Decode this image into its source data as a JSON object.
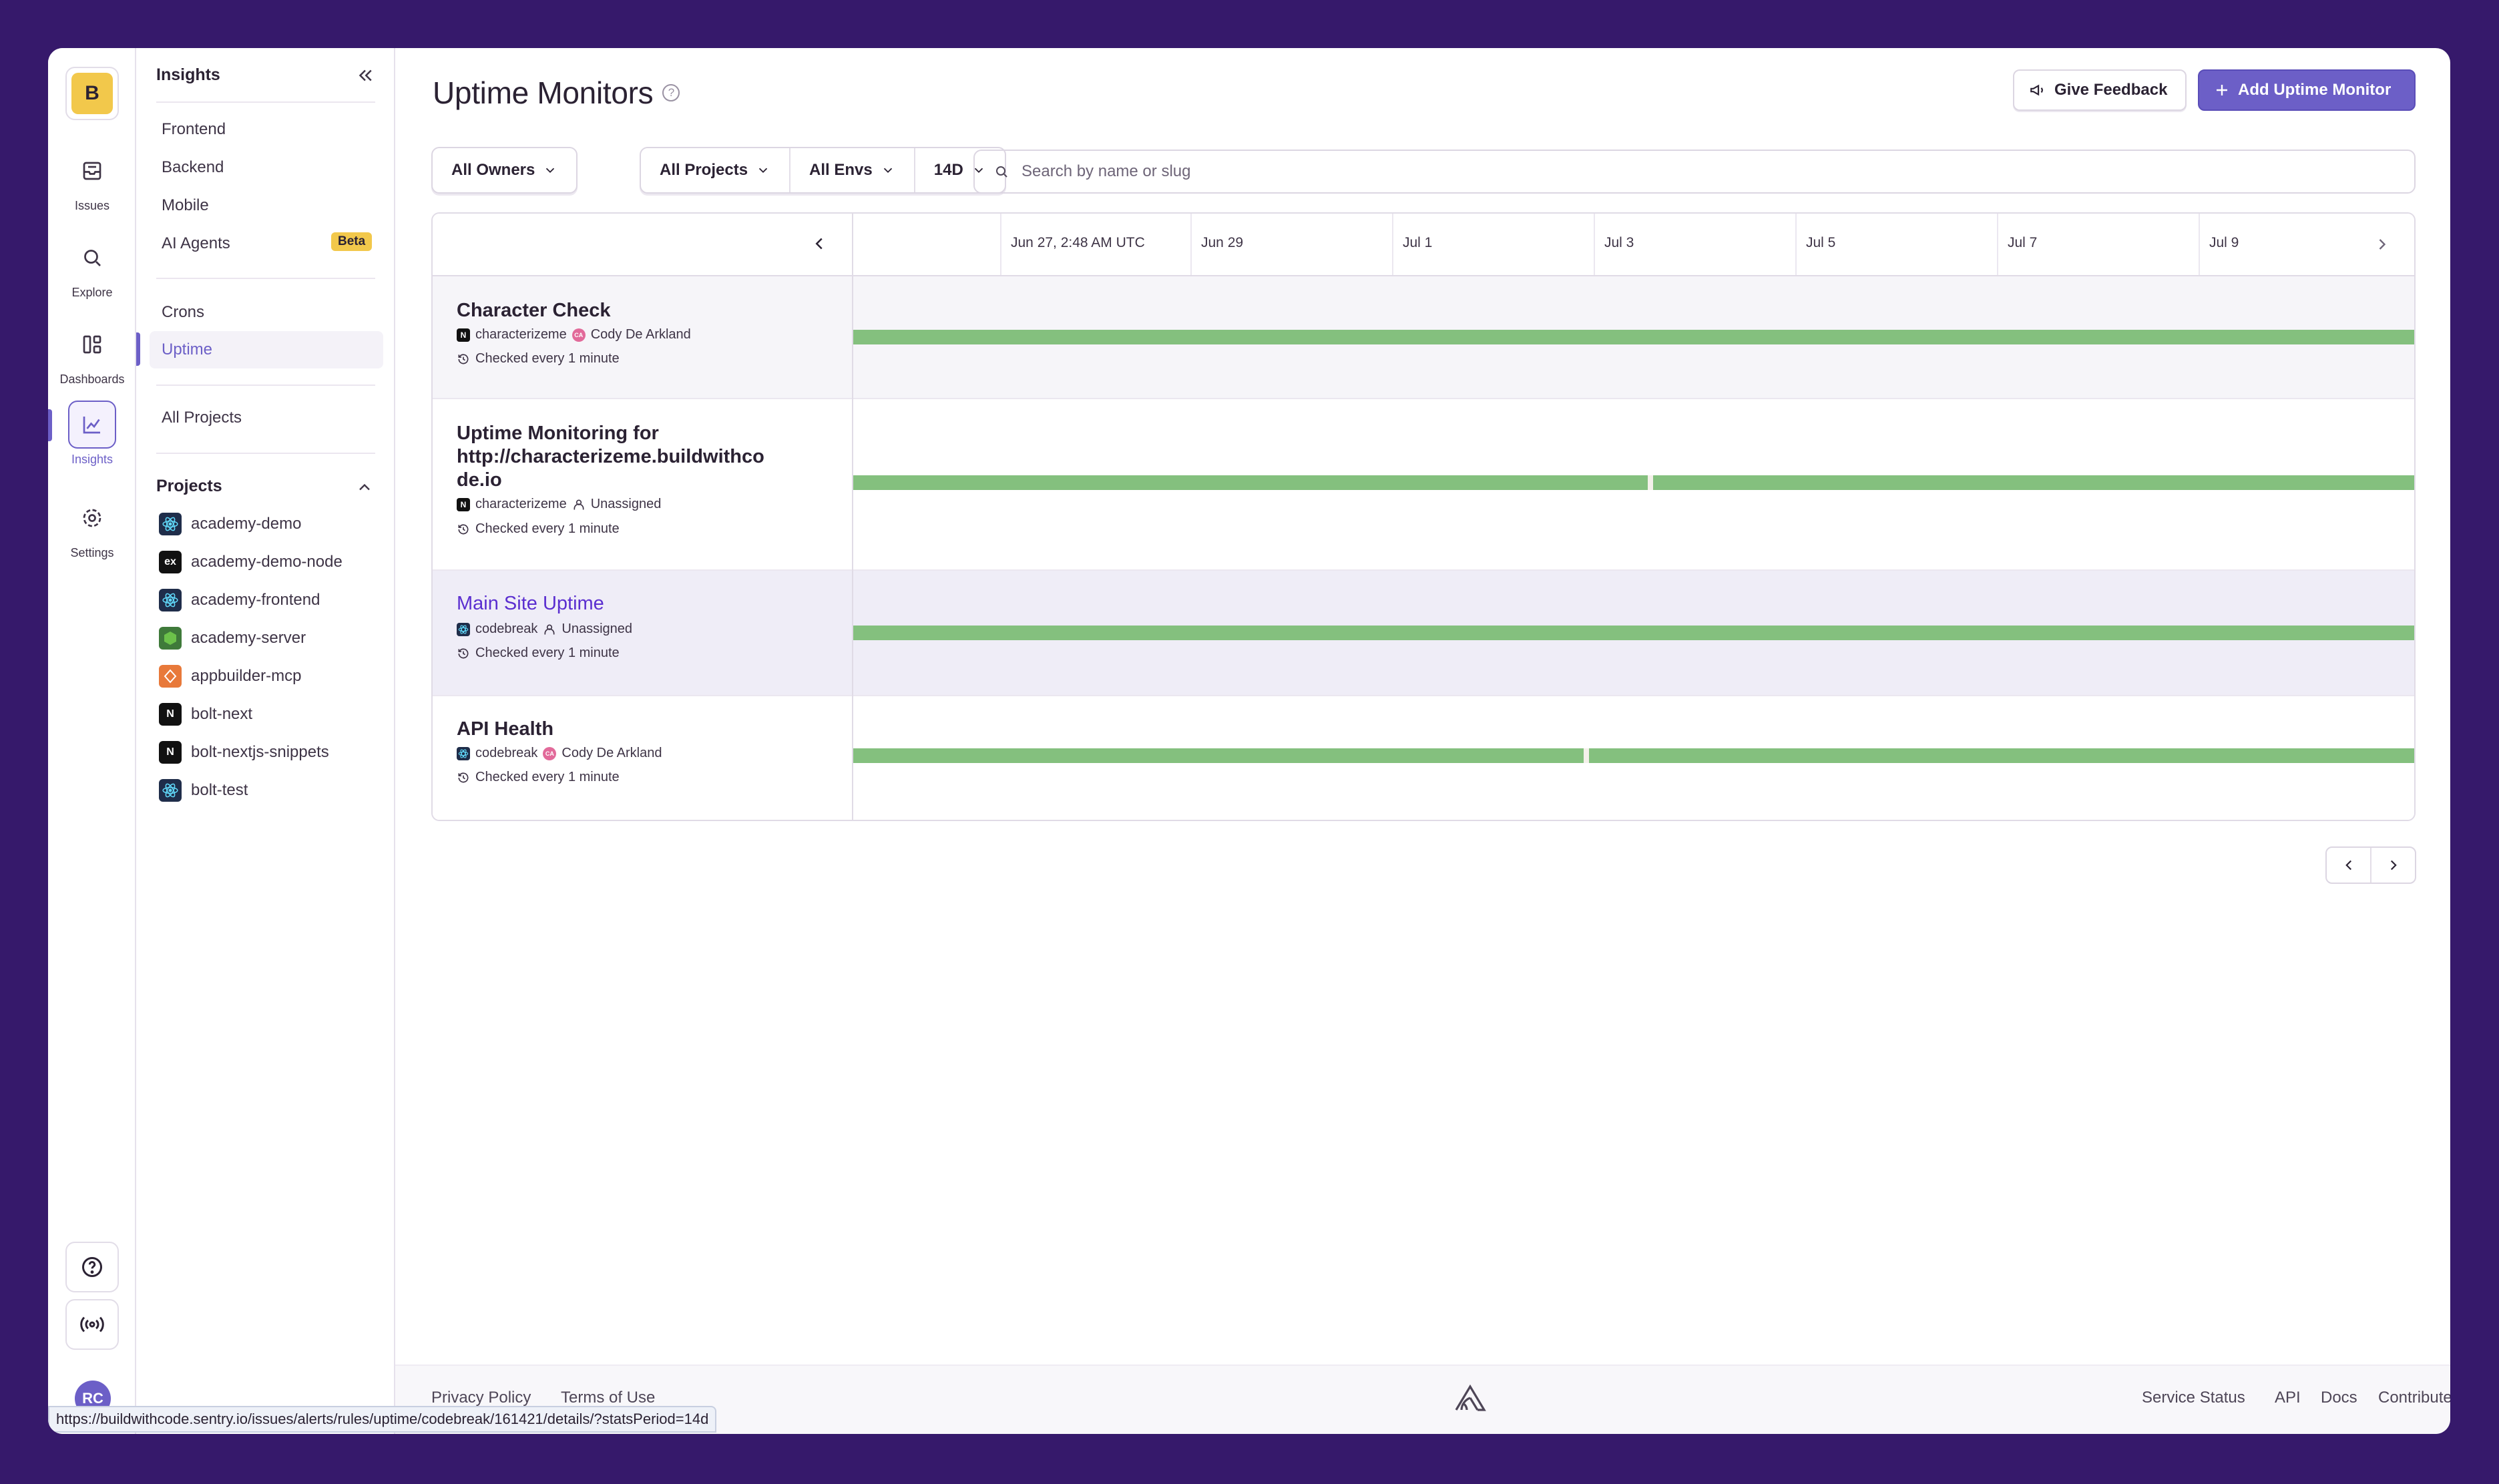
{
  "org": {
    "initial": "B"
  },
  "nav": {
    "items": [
      {
        "label": "Issues",
        "icon": "inbox-icon"
      },
      {
        "label": "Explore",
        "icon": "search-icon"
      },
      {
        "label": "Dashboards",
        "icon": "dashboard-icon"
      },
      {
        "label": "Insights",
        "icon": "chart-icon",
        "active": true
      },
      {
        "label": "Settings",
        "icon": "gear-icon"
      }
    ],
    "avatar_initials": "RC"
  },
  "sidebar": {
    "title": "Insights",
    "group1": [
      "Frontend",
      "Backend",
      "Mobile",
      "AI Agents"
    ],
    "beta_badge": "Beta",
    "group2": [
      "Crons",
      "Uptime"
    ],
    "all_projects": "All Projects",
    "projects_header": "Projects",
    "projects": [
      {
        "name": "academy-demo",
        "icon": "react-icon"
      },
      {
        "name": "academy-demo-node",
        "icon": "express-icon"
      },
      {
        "name": "academy-frontend",
        "icon": "react-icon"
      },
      {
        "name": "academy-server",
        "icon": "node-icon"
      },
      {
        "name": "appbuilder-mcp",
        "icon": "mcp-icon"
      },
      {
        "name": "bolt-next",
        "icon": "nextjs-icon"
      },
      {
        "name": "bolt-nextjs-snippets",
        "icon": "nextjs-icon"
      },
      {
        "name": "bolt-test",
        "icon": "react-icon"
      }
    ]
  },
  "header": {
    "title": "Uptime Monitors",
    "feedback_label": "Give Feedback",
    "add_label": "Add Uptime Monitor"
  },
  "filters": {
    "owners": "All Owners",
    "projects": "All Projects",
    "envs": "All Envs",
    "period": "14D",
    "search_placeholder": "Search by name or slug"
  },
  "timeline": {
    "ticks": [
      "Jun 27, 2:48 AM UTC",
      "Jun 29",
      "Jul 1",
      "Jul 3",
      "Jul 5",
      "Jul 7",
      "Jul 9"
    ]
  },
  "monitors": [
    {
      "name": "Character Check",
      "project": "characterizeme",
      "owner": "Cody De Arkland",
      "interval": "Checked every 1 minute",
      "uptime": "full"
    },
    {
      "name": "Uptime Monitoring for http://characterizeme.buildwithco de.io",
      "project": "characterizeme",
      "owner": "Unassigned",
      "interval": "Checked every 1 minute",
      "uptime": "one-gap"
    },
    {
      "name": "Main Site Uptime",
      "project": "codebreak",
      "owner": "Unassigned",
      "interval": "Checked every 1 minute",
      "uptime": "full"
    },
    {
      "name": "API Health",
      "project": "codebreak",
      "owner": "Cody De Arkland",
      "interval": "Checked every 1 minute",
      "uptime": "one-gap"
    }
  ],
  "footer": {
    "privacy": "Privacy Policy",
    "terms": "Terms of Use",
    "service_status": "Service Status",
    "api": "API",
    "docs": "Docs",
    "contribute": "Contribute"
  },
  "status_bar": {
    "url": "https://buildwithcode.sentry.io/issues/alerts/rules/uptime/codebreak/161421/details/?statsPeriod=14d"
  },
  "colors": {
    "accent": "#6c5fc7",
    "uptime_ok": "#84c07e",
    "page_bg": "#36196b",
    "beta": "#f2c84b"
  }
}
